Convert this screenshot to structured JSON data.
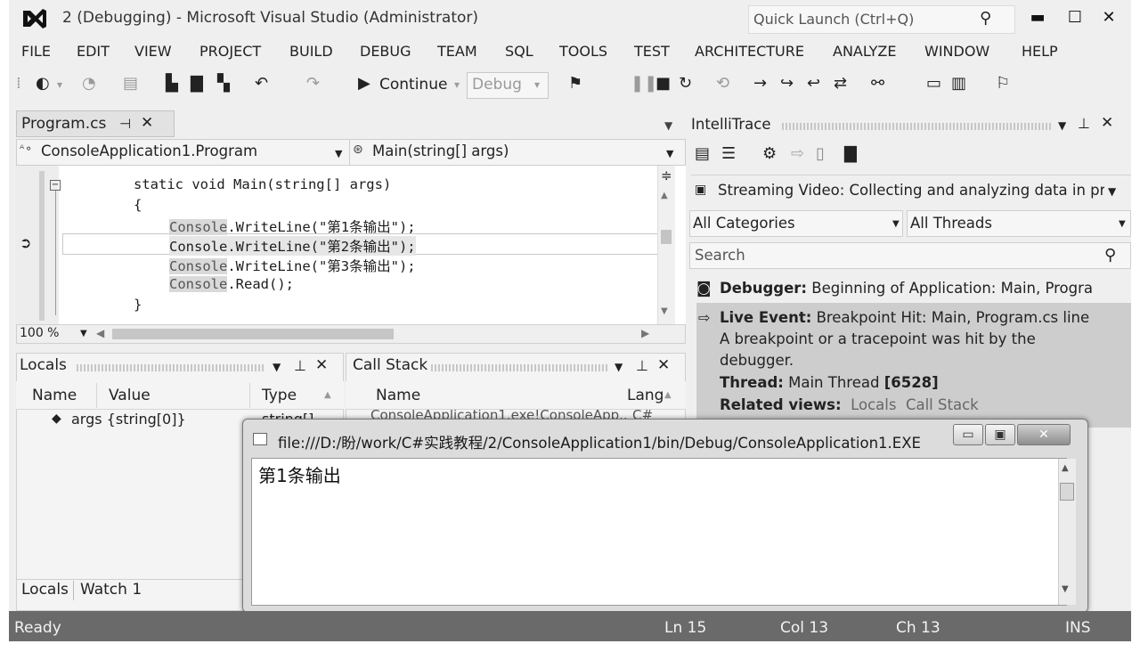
{
  "window": {
    "title": "2 (Debugging) - Microsoft Visual Studio (Administrator)",
    "quick_launch_placeholder": "Quick Launch (Ctrl+Q)",
    "minimize_glyph": "▬",
    "maximize_glyph": "☐",
    "close_glyph": "✕"
  },
  "menu": [
    "FILE",
    "EDIT",
    "VIEW",
    "PROJECT",
    "BUILD",
    "DEBUG",
    "TEAM",
    "SQL",
    "TOOLS",
    "TEST",
    "ARCHITECTURE",
    "ANALYZE",
    "WINDOW",
    "HELP"
  ],
  "toolbar": {
    "continue_label": "Continue",
    "config_value": "Debug"
  },
  "editor": {
    "tab_label": "Program.cs",
    "type_selector": "ConsoleApplication1.Program",
    "member_selector": "Main(string[] args)",
    "code": {
      "method_signature": "static void Main(string[] args)",
      "open_brace": "{",
      "console_kw": "Console",
      "line1_rest": ".WriteLine(\"第1条输出\");",
      "line2": "Console.WriteLine(\"第2条输出\");",
      "line3_rest": ".WriteLine(\"第3条输出\");",
      "line4_rest": ".Read();",
      "close_brace": "}"
    },
    "zoom": "100 %"
  },
  "locals": {
    "title": "Locals",
    "columns": [
      "Name",
      "Value",
      "Type"
    ],
    "row_value": "args {string[0]}",
    "row_type": "string[]",
    "tabs": [
      "Locals",
      "Watch 1"
    ]
  },
  "callstack": {
    "title": "Call Stack",
    "columns": [
      "Name",
      "Lang"
    ],
    "row_name": "ConsoleApplication1.exe!ConsoleApp...",
    "row_lang": "C#"
  },
  "intellitrace": {
    "title": "IntelliTrace",
    "streaming": "Streaming Video: Collecting and analyzing data in pr",
    "category_filter": "All Categories",
    "thread_filter": "All Threads",
    "search_placeholder": "Search",
    "event1_label": "Debugger:",
    "event1_text": "Beginning of Application: Main, Progra",
    "event2_label": "Live Event:",
    "event2_text": "Breakpoint Hit: Main, Program.cs line",
    "event2_desc1": "A breakpoint or a tracepoint was hit by the",
    "event2_desc2": "debugger.",
    "thread_label": "Thread:",
    "thread_value": "Main Thread",
    "thread_id": "[6528]",
    "related_label": "Related views:",
    "related_locals": "Locals",
    "related_callstack": "Call Stack"
  },
  "console_window": {
    "title": "file:///D:/盼/work/C#实践教程/2/ConsoleApplication1/bin/Debug/ConsoleApplication1.EXE",
    "output": "第1条输出",
    "min_glyph": "▭",
    "max_glyph": "▣",
    "close_glyph": "✕"
  },
  "status": {
    "text": "Ready",
    "ln": "Ln 15",
    "col": "Col 13",
    "ch": "Ch 13",
    "mode": "INS"
  }
}
